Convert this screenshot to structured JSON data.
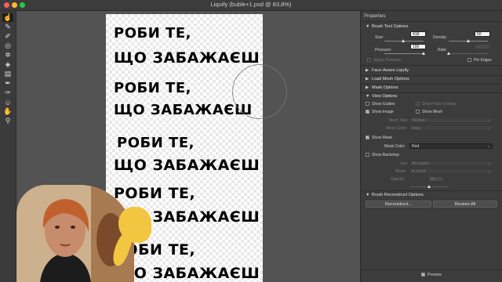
{
  "window": {
    "title": "Liquify (buble+1.psd @ 83,8%)"
  },
  "tools": [
    "warp-icon",
    "reconstruct-icon",
    "smooth-icon",
    "twirl-icon",
    "pucker-icon",
    "bloat-icon",
    "push-left-icon",
    "freeze-mask-icon",
    "thaw-mask-icon",
    "face-tool-icon",
    "hand-icon",
    "zoom-icon"
  ],
  "canvas": {
    "lines": [
      {
        "text": "РОБИ ТЕ,"
      },
      {
        "text": "ЩО ЗАБАЖАЄШ"
      },
      {
        "text": "РОБИ ТЕ,"
      },
      {
        "text": "ЩО ЗАБАЖАЄШ"
      },
      {
        "text": "РОБИ ТЕ,"
      },
      {
        "text": "ЩО ЗАБАЖАЄШ"
      },
      {
        "text": "РОБИ ТЕ,"
      },
      {
        "text": "ЩО ЗАБАЖАЄШ"
      },
      {
        "text": "РОБИ ТЕ,"
      },
      {
        "text": "ЩО ЗАБАЖАЄШ"
      }
    ]
  },
  "panel": {
    "title": "Properties",
    "brush": {
      "header": "Brush Tool Options",
      "size_label": "Size:",
      "size_value": "418",
      "size_level": 0.48,
      "density_label": "Density:",
      "density_value": "50",
      "density_level": 0.5,
      "pressure_label": "Pressure:",
      "pressure_value": "100",
      "pressure_level": 1.0,
      "rate_label": "Rate:",
      "rate_value": "",
      "rate_level": 0.0,
      "stylus_label": "Stylus Pressure",
      "pin_edges_label": "Pin Edges"
    },
    "sections": {
      "face_aware": "Face-Aware Liquify",
      "load_mesh": "Load Mesh Options",
      "mask": "Mask Options",
      "view": "View Options",
      "reconstruct": "Brush Reconstruct Options"
    },
    "view": {
      "show_guides": "Show Guides",
      "show_face_overlay": "Show Face Overlay",
      "show_image": "Show Image",
      "show_mesh": "Show Mesh",
      "mesh_size_label": "Mesh Size:",
      "mesh_size_value": "Medium",
      "mesh_color_label": "Mesh Color:",
      "mesh_color_value": "Gray",
      "show_mask": "Show Mask",
      "mask_color_label": "Mask Color:",
      "mask_color_value": "Red",
      "show_backdrop": "Show Backdrop",
      "use_label": "Use:",
      "use_value": "All Layers",
      "mode_label": "Mode:",
      "mode_value": "In Front",
      "opacity_label": "Opacity:",
      "opacity_value": "50",
      "opacity_level": 0.5
    },
    "reconstruct_btn": "Reconstruct...",
    "restore_btn": "Restore All",
    "preview": "Preview"
  },
  "colors": {
    "accent_yellow": "#f2c640",
    "panel_bg": "#3c3c3c"
  }
}
